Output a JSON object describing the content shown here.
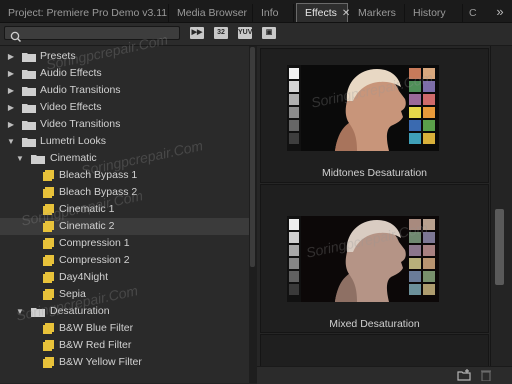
{
  "tabs": [
    {
      "label": "Project: Premiere Pro Demo v3.11",
      "active": false
    },
    {
      "label": "Media Browser",
      "active": false
    },
    {
      "label": "Info",
      "active": false
    },
    {
      "label": "Effects",
      "active": true,
      "close": "✕"
    },
    {
      "label": "Markers",
      "active": false
    },
    {
      "label": "History",
      "active": false
    },
    {
      "label": "C",
      "active": false
    }
  ],
  "overflow_glyph": "»",
  "search": {
    "value": "",
    "placeholder": ""
  },
  "toolbar_buttons": [
    "▶▶",
    "32",
    "YUV",
    "▣"
  ],
  "tree": [
    {
      "label": "Presets",
      "level": 0,
      "expanded": false,
      "kind": "folder"
    },
    {
      "label": "Audio Effects",
      "level": 0,
      "expanded": false,
      "kind": "folder"
    },
    {
      "label": "Audio Transitions",
      "level": 0,
      "expanded": false,
      "kind": "folder"
    },
    {
      "label": "Video Effects",
      "level": 0,
      "expanded": false,
      "kind": "folder"
    },
    {
      "label": "Video Transitions",
      "level": 0,
      "expanded": false,
      "kind": "folder"
    },
    {
      "label": "Lumetri Looks",
      "level": 0,
      "expanded": true,
      "kind": "folder"
    },
    {
      "label": "Cinematic",
      "level": 1,
      "expanded": true,
      "kind": "folder"
    },
    {
      "label": "Bleach Bypass 1",
      "level": 2,
      "kind": "preset"
    },
    {
      "label": "Bleach Bypass 2",
      "level": 2,
      "kind": "preset"
    },
    {
      "label": "Cinematic 1",
      "level": 2,
      "kind": "preset"
    },
    {
      "label": "Cinematic 2",
      "level": 2,
      "kind": "preset",
      "selected": true
    },
    {
      "label": "Compression 1",
      "level": 2,
      "kind": "preset"
    },
    {
      "label": "Compression 2",
      "level": 2,
      "kind": "preset"
    },
    {
      "label": "Day4Night",
      "level": 2,
      "kind": "preset"
    },
    {
      "label": "Sepia",
      "level": 2,
      "kind": "preset"
    },
    {
      "label": "Desaturation",
      "level": 1,
      "expanded": true,
      "kind": "folder"
    },
    {
      "label": "B&W Blue Filter",
      "level": 2,
      "kind": "preset"
    },
    {
      "label": "B&W Red Filter",
      "level": 2,
      "kind": "preset"
    },
    {
      "label": "B&W Yellow Filter",
      "level": 2,
      "kind": "preset"
    }
  ],
  "previews": [
    {
      "caption": "Midtones Desaturation",
      "tone": "warm"
    },
    {
      "caption": "Mixed Desaturation",
      "tone": "muted"
    }
  ],
  "watermark": "Soringpcrepair.Com",
  "colors": {
    "preset_icon": "#e8c23a",
    "folder_icon": "#cfcfcf",
    "selected_row": "#3b3b3b",
    "active_tab_border": "#6a6a6a"
  }
}
